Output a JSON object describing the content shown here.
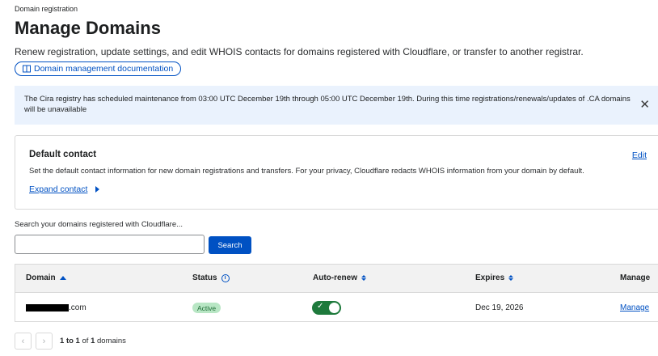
{
  "breadcrumb": "Domain registration",
  "page_title": "Manage Domains",
  "subtitle": "Renew registration, update settings, and edit WHOIS contacts for domains registered with Cloudflare, or transfer to another registrar.",
  "doc_link": {
    "label": "Domain management documentation",
    "icon": "book-icon"
  },
  "banner": {
    "text": "The Cira registry has scheduled maintenance from 03:00 UTC December 19th through 05:00 UTC December 19th. During this time registrations/renewals/updates of .CA domains will be unavailable",
    "close_icon": "close-icon",
    "background": "#eaf2fd"
  },
  "default_contact": {
    "title": "Default contact",
    "edit_label": "Edit",
    "description": "Set the default contact information for new domain registrations and transfers. For your privacy, Cloudflare redacts WHOIS information from your domain by default.",
    "expand_label": "Expand contact"
  },
  "search": {
    "label": "Search your domains registered with Cloudflare...",
    "value": "",
    "placeholder": "",
    "button_label": "Search"
  },
  "table": {
    "headers": {
      "domain": "Domain",
      "status": "Status",
      "auto_renew": "Auto-renew",
      "expires": "Expires",
      "manage": "Manage"
    },
    "rows": [
      {
        "domain_suffix": ".com",
        "status": "Active",
        "auto_renew": true,
        "expires": "Dec 19, 2026",
        "manage_label": "Manage"
      }
    ]
  },
  "pagination": {
    "range_start": "1",
    "range_end": "1",
    "total": "1",
    "sep_to": "to",
    "sep_of": "of",
    "unit": "domains"
  },
  "colors": {
    "accent": "#0051c3",
    "active_badge": "#b8e6c4",
    "toggle_on": "#1e7a3c"
  }
}
